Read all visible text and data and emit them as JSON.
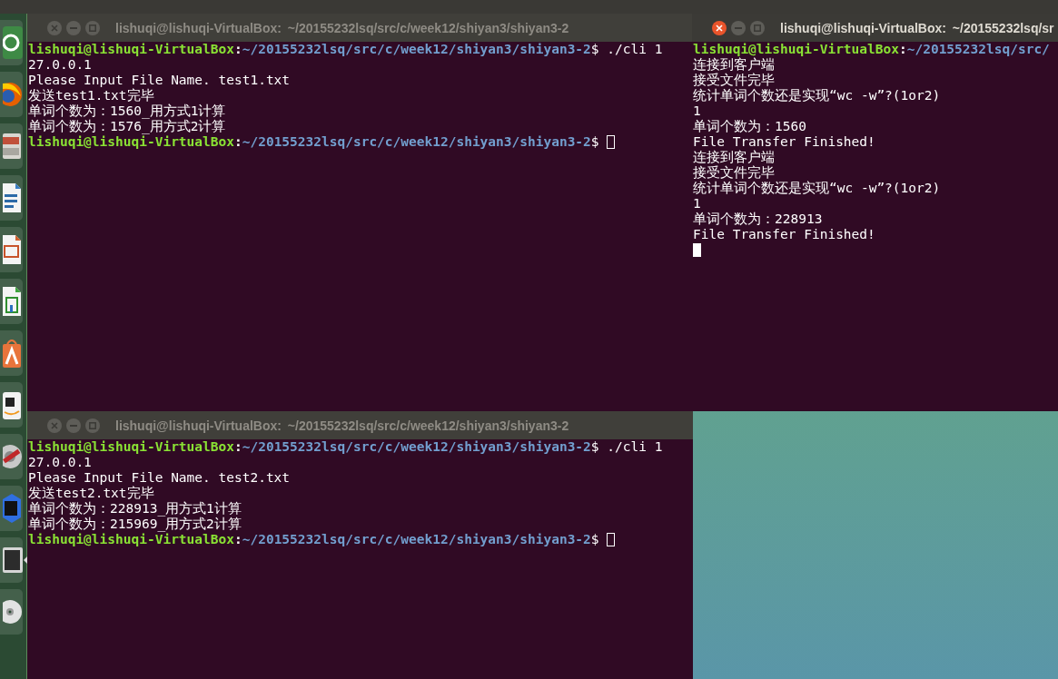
{
  "launcher": {
    "items": [
      {
        "kind": "logo",
        "active": false
      },
      {
        "kind": "browser",
        "active": false
      },
      {
        "kind": "files",
        "active": false
      },
      {
        "kind": "writer",
        "active": false
      },
      {
        "kind": "impress",
        "active": false
      },
      {
        "kind": "calc",
        "active": false
      },
      {
        "kind": "store",
        "active": false
      },
      {
        "kind": "shop",
        "active": false
      },
      {
        "kind": "settings",
        "active": false
      },
      {
        "kind": "ide",
        "active": false
      },
      {
        "kind": "terminal",
        "active": true
      },
      {
        "kind": "disc",
        "active": false
      }
    ]
  },
  "windows": [
    {
      "title": "lishuqi@lishuqi-VirtualBox: ~/20155232lsq/src/c/week12/shiyan3/shiyan3-2",
      "focused": false,
      "lines": [
        {
          "kind": "prompt",
          "user": "lishuqi@lishuqi-VirtualBox",
          "separator": ":",
          "path": "~/20155232lsq/src/c/week12/shiyan3/shiyan3-2",
          "command": "$ ./cli 1",
          "cursor": false
        },
        {
          "kind": "output",
          "text": "27.0.0.1"
        },
        {
          "kind": "output",
          "text": "Please Input File Name. test1.txt"
        },
        {
          "kind": "output",
          "text": "发送test1.txt完毕"
        },
        {
          "kind": "output",
          "text": "单词个数为：1560_用方式1计算"
        },
        {
          "kind": "output",
          "text": "单词个数为：1576_用方式2计算"
        },
        {
          "kind": "prompt",
          "user": "lishuqi@lishuqi-VirtualBox",
          "separator": ":",
          "path": "~/20155232lsq/src/c/week12/shiyan3/shiyan3-2",
          "command": "$ ",
          "cursor": true
        }
      ]
    },
    {
      "title": "lishuqi@lishuqi-VirtualBox: ~/20155232lsq/sr",
      "focused": true,
      "lines": [
        {
          "kind": "prompt",
          "user": "lishuqi@lishuqi-VirtualBox",
          "separator": ":",
          "path": "~/20155232lsq/src/",
          "cursor": false
        },
        {
          "kind": "output",
          "text": "连接到客户端"
        },
        {
          "kind": "output",
          "text": "接受文件完毕"
        },
        {
          "kind": "output",
          "text": "统计单词个数还是实现“wc -w”?(1or2)"
        },
        {
          "kind": "output",
          "text": "1"
        },
        {
          "kind": "output",
          "text": "单词个数为：1560"
        },
        {
          "kind": "output",
          "text": "File Transfer Finished!"
        },
        {
          "kind": "output",
          "text": "连接到客户端"
        },
        {
          "kind": "output",
          "text": "接受文件完毕"
        },
        {
          "kind": "output",
          "text": "统计单词个数还是实现“wc -w”?(1or2)"
        },
        {
          "kind": "output",
          "text": "1"
        },
        {
          "kind": "output",
          "text": "单词个数为：228913"
        },
        {
          "kind": "output",
          "text": "File Transfer Finished!"
        },
        {
          "kind": "cursor"
        }
      ]
    },
    {
      "title": "lishuqi@lishuqi-VirtualBox: ~/20155232lsq/src/c/week12/shiyan3/shiyan3-2",
      "focused": false,
      "lines": [
        {
          "kind": "prompt",
          "user": "lishuqi@lishuqi-VirtualBox",
          "separator": ":",
          "path": "~/20155232lsq/src/c/week12/shiyan3/shiyan3-2",
          "command": "$ ./cli 1",
          "cursor": false
        },
        {
          "kind": "output",
          "text": "27.0.0.1"
        },
        {
          "kind": "output",
          "text": "Please Input File Name. test2.txt"
        },
        {
          "kind": "output",
          "text": "发送test2.txt完毕"
        },
        {
          "kind": "output",
          "text": "单词个数为：228913_用方式1计算"
        },
        {
          "kind": "output",
          "text": "单词个数为：215969_用方式2计算"
        },
        {
          "kind": "prompt",
          "user": "lishuqi@lishuqi-VirtualBox",
          "separator": ":",
          "path": "~/20155232lsq/src/c/week12/shiyan3/shiyan3-2",
          "command": "$ ",
          "cursor": true
        }
      ]
    }
  ]
}
